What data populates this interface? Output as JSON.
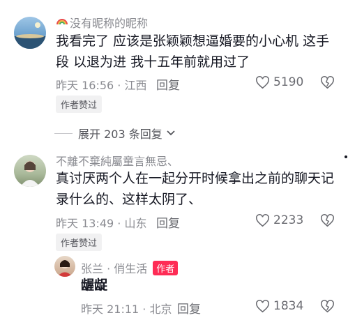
{
  "comments": [
    {
      "username": "没有昵称的昵称",
      "text": "我看完了 应该是张颖颖想逼婚要的小心机 这手段 以退为进 我十五年前就用过了",
      "time": "昨天 16:56",
      "location": "江西",
      "reply_label": "回复",
      "likes": "5190",
      "badge": "作者赞过",
      "expand_label": "展开 203 条回复"
    },
    {
      "username": "不離不棄純屬童言無忌、",
      "text": "真讨厌两个人在一起分开时候拿出之前的聊天记录什么的、这样太阴了、",
      "time": "昨天 13:49",
      "location": "山东",
      "reply_label": "回复",
      "likes": "2233",
      "badge": "作者赞过",
      "reply": {
        "username": "张兰 · 俏生活",
        "author_tag": "作者",
        "text": "龌龊",
        "time": "昨天 21:11",
        "location": "北京",
        "reply_label": "回复",
        "likes": "1834"
      }
    }
  ],
  "colors": {
    "accent": "#fe2c55",
    "meta": "#8a8b91",
    "text": "#161823"
  }
}
